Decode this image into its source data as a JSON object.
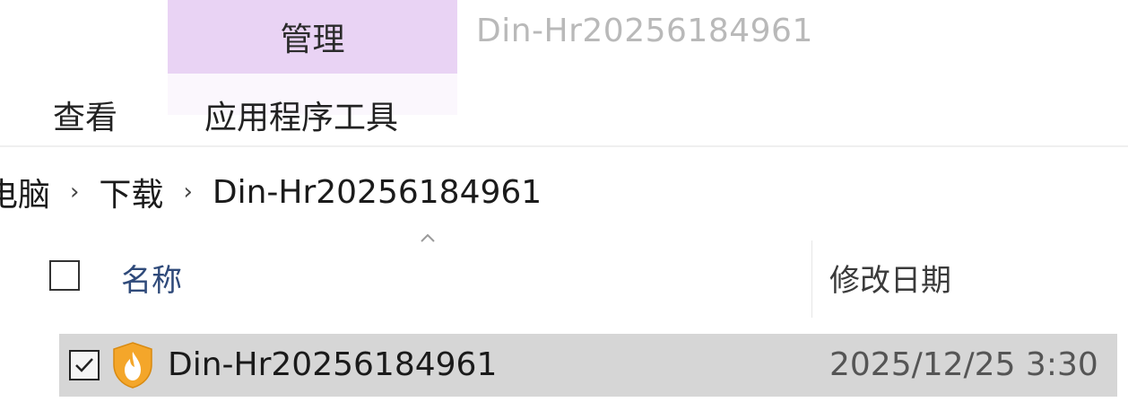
{
  "ribbon": {
    "manage_tab": "管理",
    "view_tab": "查看",
    "app_tools_tab": "应用程序工具",
    "window_title": "Din-Hr20256184961"
  },
  "breadcrumb": {
    "items": [
      "电脑",
      "下载",
      "Din-Hr20256184961"
    ],
    "separator": "›"
  },
  "list_header": {
    "name_label": "名称",
    "date_label": "修改日期",
    "sorted_column": "名称",
    "sort_direction": "ascending"
  },
  "files": [
    {
      "name": "Din-Hr20256184961",
      "modified": "2025/12/25 3:30",
      "selected": true,
      "icon": "shield-app-icon"
    }
  ],
  "colors": {
    "manage_tab_bg": "#e9d3f4",
    "selected_row_bg": "#d6d6d6",
    "icon_orange": "#f4a62a"
  }
}
